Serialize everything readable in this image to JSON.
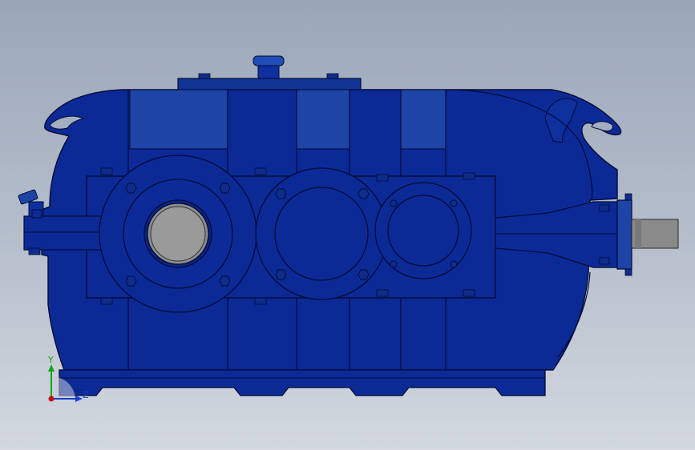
{
  "viewport": {
    "background_top": "#9aa6b8",
    "background_bottom": "#d3d8e0"
  },
  "model": {
    "body_color": "#0c2a96",
    "highlight_color": "#1d44a6",
    "edge_color": "#020a36",
    "shaft_color": "#8a8a8a",
    "bore_color": "#8e8e8e"
  },
  "triad": {
    "y_label": "Y",
    "z_label": "Z",
    "y_color": "#11a411",
    "z_color": "#1a3fd0",
    "origin_color": "#c01010"
  }
}
